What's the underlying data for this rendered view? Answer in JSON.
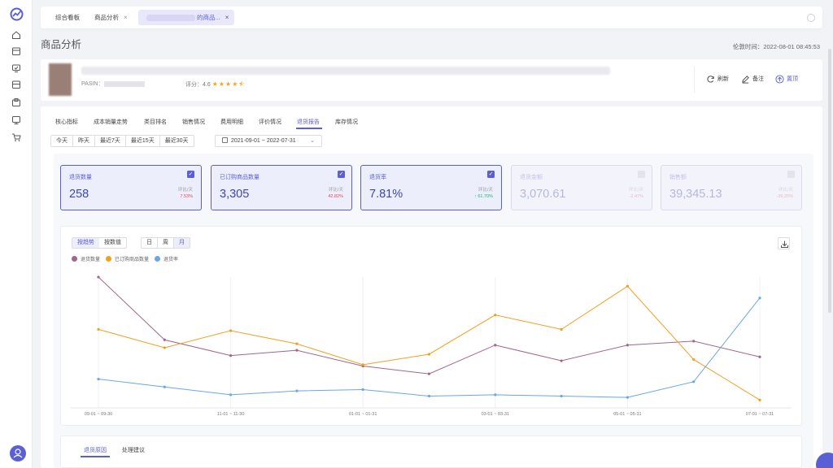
{
  "sidebar": {
    "icons": [
      "logo-icon",
      "home-icon",
      "box-icon",
      "monitor-check-icon",
      "store-icon",
      "package-icon",
      "desktop-icon",
      "cart-icon"
    ]
  },
  "tabs": [
    {
      "label": "综合看板",
      "closable": false
    },
    {
      "label": "商品分析",
      "closable": true
    },
    {
      "label": "的商品...",
      "closable": true,
      "active": true
    }
  ],
  "page": {
    "title": "商品分析",
    "update_time": "伦敦时间：2022-08-01 08:45:53"
  },
  "product": {
    "pasin_label": "PASIN：",
    "rating_label": "评分：",
    "rating_value": "4.6",
    "stars": "★★★★⯪",
    "actions": [
      {
        "label": "刷新",
        "icon": "refresh-icon"
      },
      {
        "label": "备注",
        "icon": "edit-icon"
      },
      {
        "label": "置顶",
        "icon": "arrow-up-circle-icon"
      }
    ]
  },
  "subtabs": [
    "核心指标",
    "成本销量走势",
    "类目排名",
    "销售情况",
    "费用明细",
    "评价情况",
    "退货报告",
    "库存情况"
  ],
  "active_subtab": 6,
  "date_buttons": [
    "今天",
    "昨天",
    "最近7天",
    "最近15天",
    "最近30天"
  ],
  "date_range": {
    "start": "2021-09-01",
    "sep": "~",
    "end": "2022-07-31"
  },
  "metrics": [
    {
      "label": "退货数量",
      "value": "258",
      "compare_label": "环比/天",
      "compare": "7.53%",
      "checked": true,
      "trend": "down"
    },
    {
      "label": "已订购商品数量",
      "value": "3,305",
      "compare_label": "环比/天",
      "compare": "42.82%",
      "checked": true,
      "trend": "down"
    },
    {
      "label": "退货率",
      "value": "7.81%",
      "compare_label": "环比/天",
      "compare": "↑ 61.70%",
      "checked": true,
      "trend": "up"
    },
    {
      "label": "退货金额",
      "value": "3,070.61",
      "compare_label": "环比/天",
      "compare": "-2.47%",
      "checked": false,
      "trend": "down"
    },
    {
      "label": "销售额",
      "value": "39,345.13",
      "compare_label": "环比/天",
      "compare": "-39.25%",
      "checked": false,
      "trend": "down"
    }
  ],
  "chart_controls": {
    "mode": [
      "按趋势",
      "按数值"
    ],
    "granularity": [
      "日",
      "周",
      "月"
    ],
    "active_mode": 0,
    "active_granularity": 2
  },
  "chart_data": {
    "type": "line",
    "categories": [
      "09-01 ~ 09-30",
      "10-01 ~ 10-31",
      "11-01 ~ 11-30",
      "12-01 ~ 12-31",
      "01-01 ~ 01-31",
      "02-01 ~ 02-28",
      "03-01 ~ 03-31",
      "04-01 ~ 04-30",
      "05-01 ~ 05-31",
      "06-01 ~ 06-30",
      "07-01 ~ 07-31"
    ],
    "shown_tick_labels": [
      "09-01 ~ 09-30",
      "11-01 ~ 11-30",
      "01-01 ~ 01-31",
      "03-01 ~ 03-31",
      "05-01 ~ 05-31",
      "07-01 ~ 07-31"
    ],
    "series": [
      {
        "name": "退货数量",
        "color": "#a0668c",
        "values": [
          100,
          52,
          40,
          44,
          32,
          26,
          48,
          36,
          48,
          51,
          39
        ]
      },
      {
        "name": "已订购商品数量",
        "color": "#f0a020",
        "values": [
          60,
          46,
          59,
          49,
          33,
          41,
          71,
          60,
          93,
          37,
          6
        ]
      },
      {
        "name": "退货率",
        "color": "#6aa6e8",
        "values": [
          22,
          16,
          10,
          13,
          14,
          9,
          10,
          9,
          8,
          20,
          84
        ]
      }
    ],
    "ylim": [
      0,
      100
    ],
    "grid": "vertical",
    "legend": "top-left"
  },
  "bottom_tabs": [
    "退货原因",
    "处理建议"
  ]
}
